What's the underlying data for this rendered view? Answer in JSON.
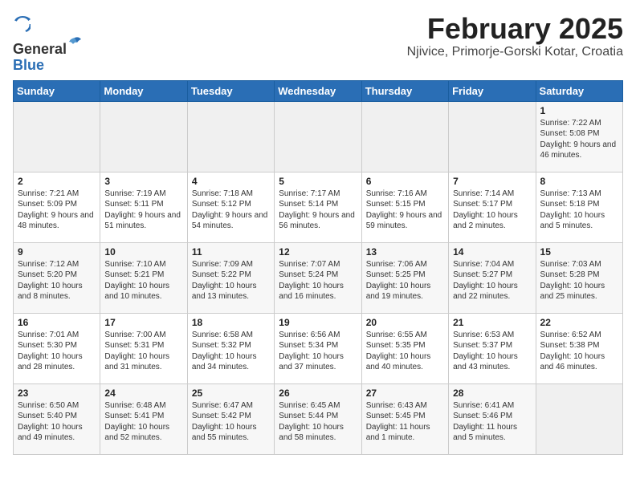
{
  "header": {
    "logo_general": "General",
    "logo_blue": "Blue",
    "month_title": "February 2025",
    "location": "Njivice, Primorje-Gorski Kotar, Croatia"
  },
  "weekdays": [
    "Sunday",
    "Monday",
    "Tuesday",
    "Wednesday",
    "Thursday",
    "Friday",
    "Saturday"
  ],
  "weeks": [
    [
      {
        "day": "",
        "info": ""
      },
      {
        "day": "",
        "info": ""
      },
      {
        "day": "",
        "info": ""
      },
      {
        "day": "",
        "info": ""
      },
      {
        "day": "",
        "info": ""
      },
      {
        "day": "",
        "info": ""
      },
      {
        "day": "1",
        "info": "Sunrise: 7:22 AM\nSunset: 5:08 PM\nDaylight: 9 hours and 46 minutes."
      }
    ],
    [
      {
        "day": "2",
        "info": "Sunrise: 7:21 AM\nSunset: 5:09 PM\nDaylight: 9 hours and 48 minutes."
      },
      {
        "day": "3",
        "info": "Sunrise: 7:19 AM\nSunset: 5:11 PM\nDaylight: 9 hours and 51 minutes."
      },
      {
        "day": "4",
        "info": "Sunrise: 7:18 AM\nSunset: 5:12 PM\nDaylight: 9 hours and 54 minutes."
      },
      {
        "day": "5",
        "info": "Sunrise: 7:17 AM\nSunset: 5:14 PM\nDaylight: 9 hours and 56 minutes."
      },
      {
        "day": "6",
        "info": "Sunrise: 7:16 AM\nSunset: 5:15 PM\nDaylight: 9 hours and 59 minutes."
      },
      {
        "day": "7",
        "info": "Sunrise: 7:14 AM\nSunset: 5:17 PM\nDaylight: 10 hours and 2 minutes."
      },
      {
        "day": "8",
        "info": "Sunrise: 7:13 AM\nSunset: 5:18 PM\nDaylight: 10 hours and 5 minutes."
      }
    ],
    [
      {
        "day": "9",
        "info": "Sunrise: 7:12 AM\nSunset: 5:20 PM\nDaylight: 10 hours and 8 minutes."
      },
      {
        "day": "10",
        "info": "Sunrise: 7:10 AM\nSunset: 5:21 PM\nDaylight: 10 hours and 10 minutes."
      },
      {
        "day": "11",
        "info": "Sunrise: 7:09 AM\nSunset: 5:22 PM\nDaylight: 10 hours and 13 minutes."
      },
      {
        "day": "12",
        "info": "Sunrise: 7:07 AM\nSunset: 5:24 PM\nDaylight: 10 hours and 16 minutes."
      },
      {
        "day": "13",
        "info": "Sunrise: 7:06 AM\nSunset: 5:25 PM\nDaylight: 10 hours and 19 minutes."
      },
      {
        "day": "14",
        "info": "Sunrise: 7:04 AM\nSunset: 5:27 PM\nDaylight: 10 hours and 22 minutes."
      },
      {
        "day": "15",
        "info": "Sunrise: 7:03 AM\nSunset: 5:28 PM\nDaylight: 10 hours and 25 minutes."
      }
    ],
    [
      {
        "day": "16",
        "info": "Sunrise: 7:01 AM\nSunset: 5:30 PM\nDaylight: 10 hours and 28 minutes."
      },
      {
        "day": "17",
        "info": "Sunrise: 7:00 AM\nSunset: 5:31 PM\nDaylight: 10 hours and 31 minutes."
      },
      {
        "day": "18",
        "info": "Sunrise: 6:58 AM\nSunset: 5:32 PM\nDaylight: 10 hours and 34 minutes."
      },
      {
        "day": "19",
        "info": "Sunrise: 6:56 AM\nSunset: 5:34 PM\nDaylight: 10 hours and 37 minutes."
      },
      {
        "day": "20",
        "info": "Sunrise: 6:55 AM\nSunset: 5:35 PM\nDaylight: 10 hours and 40 minutes."
      },
      {
        "day": "21",
        "info": "Sunrise: 6:53 AM\nSunset: 5:37 PM\nDaylight: 10 hours and 43 minutes."
      },
      {
        "day": "22",
        "info": "Sunrise: 6:52 AM\nSunset: 5:38 PM\nDaylight: 10 hours and 46 minutes."
      }
    ],
    [
      {
        "day": "23",
        "info": "Sunrise: 6:50 AM\nSunset: 5:40 PM\nDaylight: 10 hours and 49 minutes."
      },
      {
        "day": "24",
        "info": "Sunrise: 6:48 AM\nSunset: 5:41 PM\nDaylight: 10 hours and 52 minutes."
      },
      {
        "day": "25",
        "info": "Sunrise: 6:47 AM\nSunset: 5:42 PM\nDaylight: 10 hours and 55 minutes."
      },
      {
        "day": "26",
        "info": "Sunrise: 6:45 AM\nSunset: 5:44 PM\nDaylight: 10 hours and 58 minutes."
      },
      {
        "day": "27",
        "info": "Sunrise: 6:43 AM\nSunset: 5:45 PM\nDaylight: 11 hours and 1 minute."
      },
      {
        "day": "28",
        "info": "Sunrise: 6:41 AM\nSunset: 5:46 PM\nDaylight: 11 hours and 5 minutes."
      },
      {
        "day": "",
        "info": ""
      }
    ]
  ]
}
